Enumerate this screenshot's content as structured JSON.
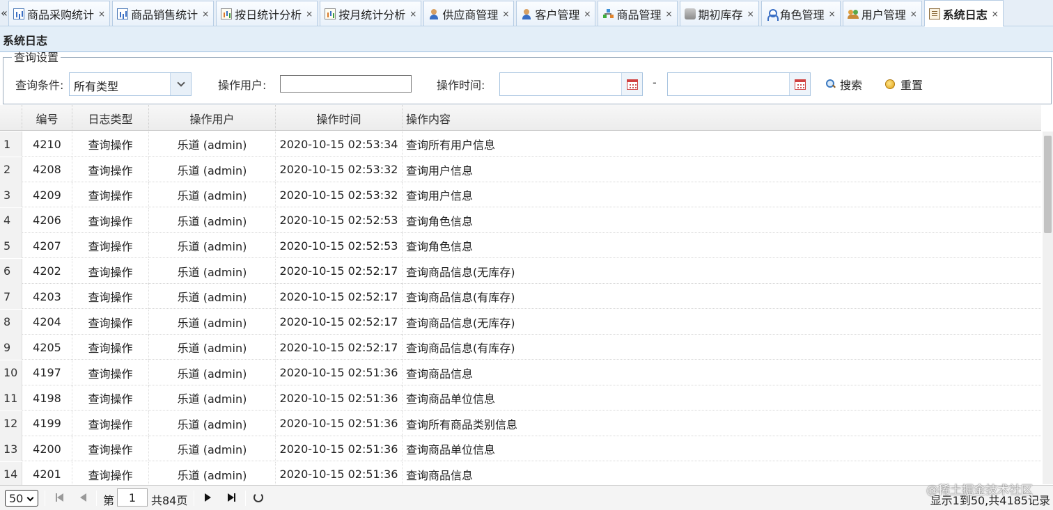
{
  "tabs": [
    {
      "label": "商品采购统计",
      "icon": "chart-icon",
      "active": false
    },
    {
      "label": "商品销售统计",
      "icon": "chart-icon",
      "active": false
    },
    {
      "label": "按日统计分析",
      "icon": "document-chart-icon",
      "active": false
    },
    {
      "label": "按月统计分析",
      "icon": "document-chart-icon",
      "active": false
    },
    {
      "label": "供应商管理",
      "icon": "user-icon",
      "active": false
    },
    {
      "label": "客户管理",
      "icon": "user-icon",
      "active": false
    },
    {
      "label": "商品管理",
      "icon": "tree-icon",
      "active": false
    },
    {
      "label": "期初库存",
      "icon": "database-icon",
      "active": false
    },
    {
      "label": "角色管理",
      "icon": "role-icon",
      "active": false
    },
    {
      "label": "用户管理",
      "icon": "users-icon",
      "active": false
    },
    {
      "label": "系统日志",
      "icon": "log-icon",
      "active": true
    }
  ],
  "tab_scroll_label": "«",
  "tab_close_label": "×",
  "page_title": "系统日志",
  "query": {
    "legend": "查询设置",
    "condition_label": "查询条件:",
    "condition_value": "所有类型",
    "user_label": "操作用户:",
    "user_value": "",
    "time_label": "操作时间:",
    "time_start": "",
    "time_end": "",
    "time_separator": "-",
    "search_label": "搜索",
    "reset_label": "重置"
  },
  "table": {
    "columns": [
      "编号",
      "日志类型",
      "操作用户",
      "操作时间",
      "操作内容"
    ],
    "rows": [
      {
        "num": "1",
        "id": "4210",
        "type": "查询操作",
        "user": "乐道 (admin)",
        "time": "2020-10-15 02:53:34",
        "content": "查询所有用户信息"
      },
      {
        "num": "2",
        "id": "4208",
        "type": "查询操作",
        "user": "乐道 (admin)",
        "time": "2020-10-15 02:53:32",
        "content": "查询用户信息"
      },
      {
        "num": "3",
        "id": "4209",
        "type": "查询操作",
        "user": "乐道 (admin)",
        "time": "2020-10-15 02:53:32",
        "content": "查询用户信息"
      },
      {
        "num": "4",
        "id": "4206",
        "type": "查询操作",
        "user": "乐道 (admin)",
        "time": "2020-10-15 02:52:53",
        "content": "查询角色信息"
      },
      {
        "num": "5",
        "id": "4207",
        "type": "查询操作",
        "user": "乐道 (admin)",
        "time": "2020-10-15 02:52:53",
        "content": "查询角色信息"
      },
      {
        "num": "6",
        "id": "4202",
        "type": "查询操作",
        "user": "乐道 (admin)",
        "time": "2020-10-15 02:52:17",
        "content": "查询商品信息(无库存)"
      },
      {
        "num": "7",
        "id": "4203",
        "type": "查询操作",
        "user": "乐道 (admin)",
        "time": "2020-10-15 02:52:17",
        "content": "查询商品信息(有库存)"
      },
      {
        "num": "8",
        "id": "4204",
        "type": "查询操作",
        "user": "乐道 (admin)",
        "time": "2020-10-15 02:52:17",
        "content": "查询商品信息(无库存)"
      },
      {
        "num": "9",
        "id": "4205",
        "type": "查询操作",
        "user": "乐道 (admin)",
        "time": "2020-10-15 02:52:17",
        "content": "查询商品信息(有库存)"
      },
      {
        "num": "10",
        "id": "4197",
        "type": "查询操作",
        "user": "乐道 (admin)",
        "time": "2020-10-15 02:51:36",
        "content": "查询商品信息"
      },
      {
        "num": "11",
        "id": "4198",
        "type": "查询操作",
        "user": "乐道 (admin)",
        "time": "2020-10-15 02:51:36",
        "content": "查询商品单位信息"
      },
      {
        "num": "12",
        "id": "4199",
        "type": "查询操作",
        "user": "乐道 (admin)",
        "time": "2020-10-15 02:51:36",
        "content": "查询所有商品类别信息"
      },
      {
        "num": "13",
        "id": "4200",
        "type": "查询操作",
        "user": "乐道 (admin)",
        "time": "2020-10-15 02:51:36",
        "content": "查询商品单位信息"
      },
      {
        "num": "14",
        "id": "4201",
        "type": "查询操作",
        "user": "乐道 (admin)",
        "time": "2020-10-15 02:51:36",
        "content": "查询商品信息"
      }
    ]
  },
  "pager": {
    "page_size": "50",
    "page_prefix": "第",
    "page_value": "1",
    "page_suffix": "共84页",
    "info": "显示1到50,共4185记录"
  },
  "watermark": "@稀土掘金技术社区",
  "colors": {
    "tab_bar_bg": "#e6eef7",
    "title_bar_bg": "#e3eef8",
    "border_blue": "#9fc0df"
  }
}
